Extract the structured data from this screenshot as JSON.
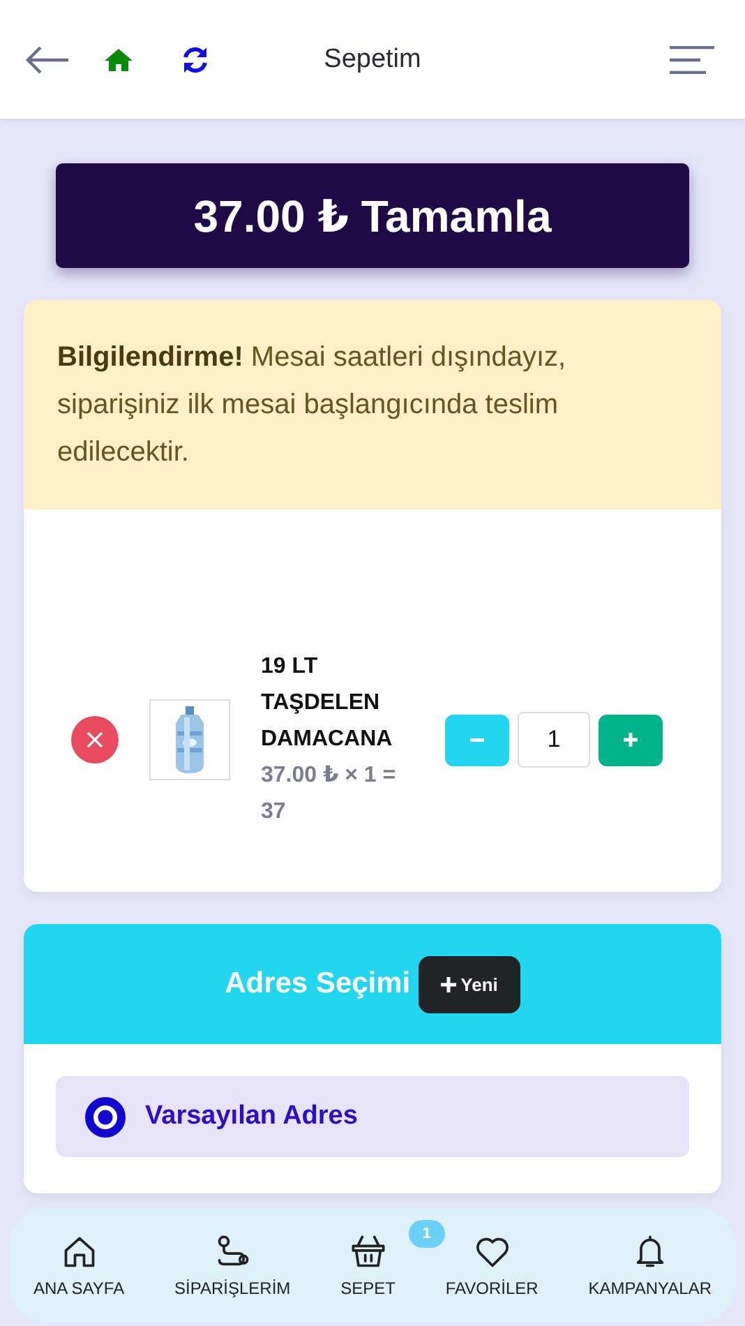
{
  "header": {
    "title": "Sepetim"
  },
  "checkout_button": {
    "label": "37.00 ₺ Tamamla"
  },
  "alert": {
    "title": "Bilgilendirme!",
    "message": "Mesai saatleri dışındayız, siparişiniz ilk mesai başlangıcında teslim edilecektir."
  },
  "cart_items": [
    {
      "name": "19 LT TAŞDELEN DAMACANA",
      "price_line": "37.00 ₺ × 1 = 37",
      "quantity": "1"
    }
  ],
  "address": {
    "title": "Adres Seçimi",
    "new_button": "Yeni",
    "options": [
      {
        "label": "Varsayılan Adres",
        "selected": true
      }
    ]
  },
  "bottom_nav": [
    {
      "label": "ANA SAYFA"
    },
    {
      "label": "SİPARİŞLERİM"
    },
    {
      "label": "SEPET",
      "badge": "1"
    },
    {
      "label": "FAVORİLER"
    },
    {
      "label": "KAMPANYALAR"
    }
  ]
}
